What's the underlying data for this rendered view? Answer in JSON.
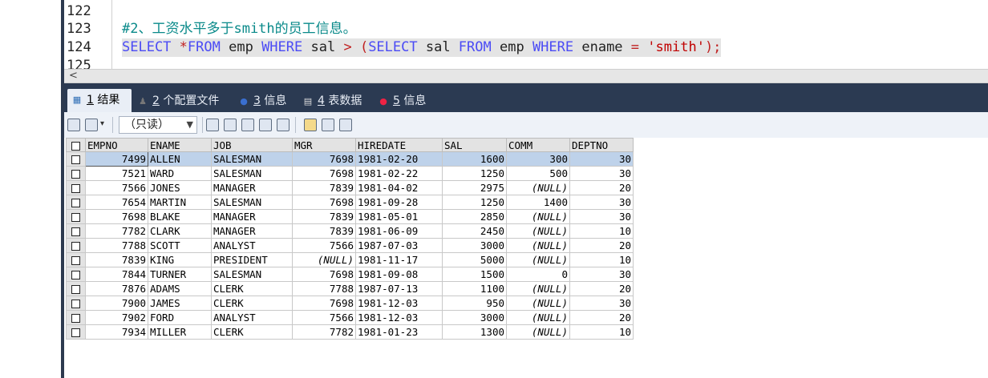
{
  "editor": {
    "lines": [
      {
        "num": "122",
        "code": []
      },
      {
        "num": "123",
        "code": [
          {
            "t": "#2、工资水平多于smith的员工信息。",
            "c": "cm"
          }
        ]
      },
      {
        "num": "124",
        "code": [
          {
            "t": "SELECT",
            "c": "kw"
          },
          {
            "t": " ",
            "c": "id"
          },
          {
            "t": "*",
            "c": "op"
          },
          {
            "t": "FROM",
            "c": "kw"
          },
          {
            "t": " emp ",
            "c": "id"
          },
          {
            "t": "WHERE",
            "c": "kw"
          },
          {
            "t": " sal ",
            "c": "id"
          },
          {
            "t": ">",
            "c": "op"
          },
          {
            "t": " ",
            "c": "id"
          },
          {
            "t": "(",
            "c": "op"
          },
          {
            "t": "SELECT",
            "c": "kw"
          },
          {
            "t": " sal ",
            "c": "id"
          },
          {
            "t": "FROM",
            "c": "kw"
          },
          {
            "t": " emp ",
            "c": "id"
          },
          {
            "t": "WHERE",
            "c": "kw"
          },
          {
            "t": " ename ",
            "c": "id"
          },
          {
            "t": "=",
            "c": "op"
          },
          {
            "t": " ",
            "c": "id"
          },
          {
            "t": "'smith'",
            "c": "str"
          },
          {
            "t": ");",
            "c": "op"
          }
        ]
      },
      {
        "num": "125",
        "code": []
      }
    ]
  },
  "scroll": {
    "left_arrow": "<"
  },
  "tabs": [
    {
      "num": "1",
      "label": "结果",
      "icon": "grid-icon"
    },
    {
      "num": "2",
      "label": "个配置文件",
      "icon": "profile-icon"
    },
    {
      "num": "3",
      "label": "信息",
      "icon": "info-icon"
    },
    {
      "num": "4",
      "label": "表数据",
      "icon": "table-icon"
    },
    {
      "num": "5",
      "label": "信息",
      "icon": "info-icon"
    }
  ],
  "toolbar": {
    "mode": "（只读）"
  },
  "grid": {
    "columns": [
      "EMPNO",
      "ENAME",
      "JOB",
      "MGR",
      "HIREDATE",
      "SAL",
      "COMM",
      "DEPTNO"
    ],
    "rows": [
      [
        "7499",
        "ALLEN",
        "SALESMAN",
        "7698",
        "1981-02-20",
        "1600",
        "300",
        "30"
      ],
      [
        "7521",
        "WARD",
        "SALESMAN",
        "7698",
        "1981-02-22",
        "1250",
        "500",
        "30"
      ],
      [
        "7566",
        "JONES",
        "MANAGER",
        "7839",
        "1981-04-02",
        "2975",
        "(NULL)",
        "20"
      ],
      [
        "7654",
        "MARTIN",
        "SALESMAN",
        "7698",
        "1981-09-28",
        "1250",
        "1400",
        "30"
      ],
      [
        "7698",
        "BLAKE",
        "MANAGER",
        "7839",
        "1981-05-01",
        "2850",
        "(NULL)",
        "30"
      ],
      [
        "7782",
        "CLARK",
        "MANAGER",
        "7839",
        "1981-06-09",
        "2450",
        "(NULL)",
        "10"
      ],
      [
        "7788",
        "SCOTT",
        "ANALYST",
        "7566",
        "1987-07-03",
        "3000",
        "(NULL)",
        "20"
      ],
      [
        "7839",
        "KING",
        "PRESIDENT",
        "(NULL)",
        "1981-11-17",
        "5000",
        "(NULL)",
        "10"
      ],
      [
        "7844",
        "TURNER",
        "SALESMAN",
        "7698",
        "1981-09-08",
        "1500",
        "0",
        "30"
      ],
      [
        "7876",
        "ADAMS",
        "CLERK",
        "7788",
        "1987-07-13",
        "1100",
        "(NULL)",
        "20"
      ],
      [
        "7900",
        "JAMES",
        "CLERK",
        "7698",
        "1981-12-03",
        "950",
        "(NULL)",
        "30"
      ],
      [
        "7902",
        "FORD",
        "ANALYST",
        "7566",
        "1981-12-03",
        "3000",
        "(NULL)",
        "20"
      ],
      [
        "7934",
        "MILLER",
        "CLERK",
        "7782",
        "1981-01-23",
        "1300",
        "(NULL)",
        "10"
      ]
    ],
    "selected_row": 0
  },
  "colors": {
    "tabbar": "#2b3a52",
    "keyword": "#4b4bf5",
    "comment": "#0a8a8a",
    "string": "#c00000",
    "selection": "#bed2ea"
  }
}
